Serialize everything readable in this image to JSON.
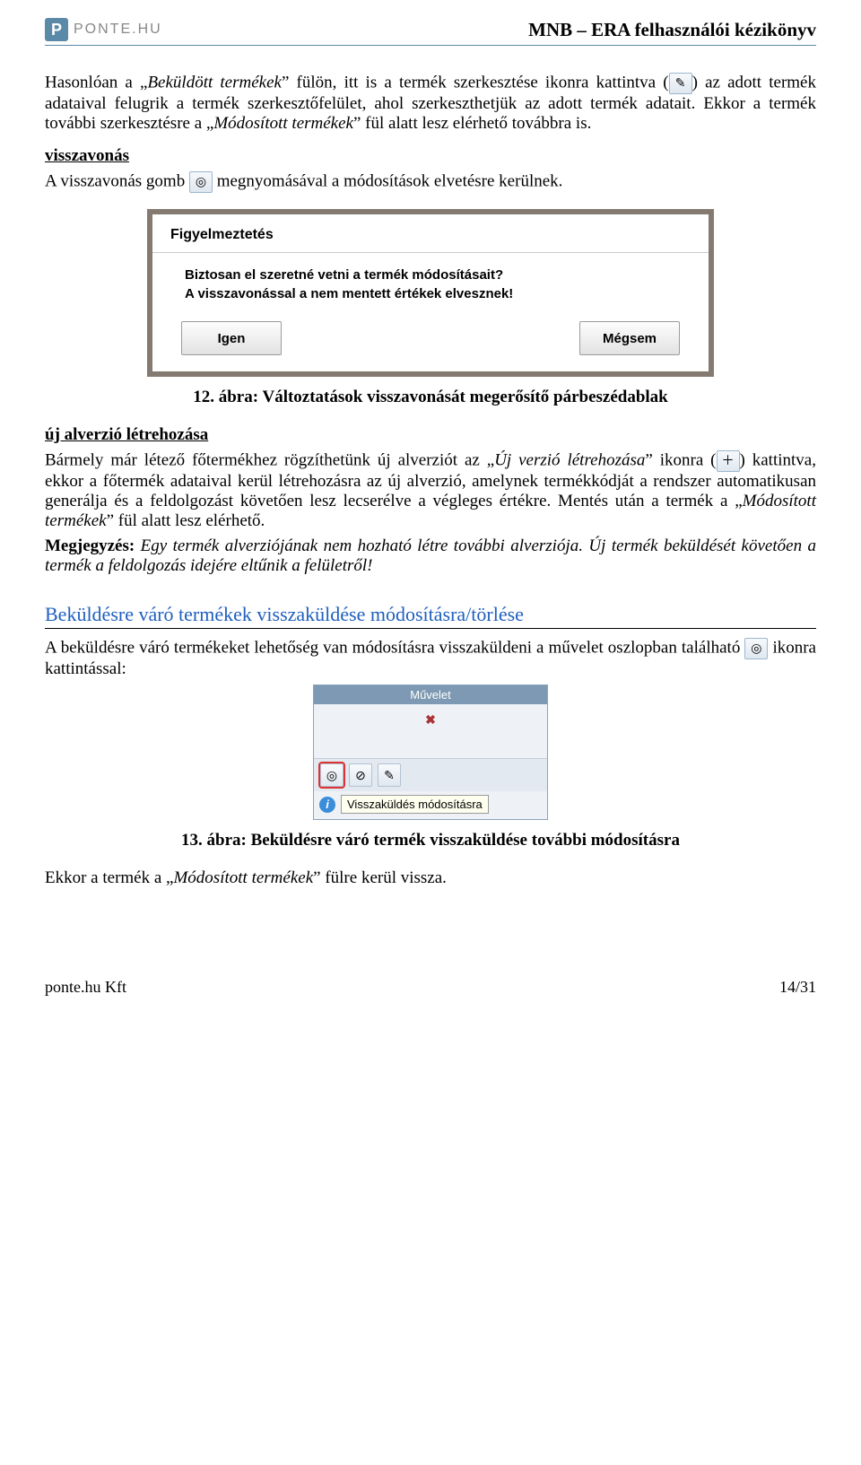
{
  "header": {
    "logo_text": "PONTE.HU",
    "doc_title": "MNB – ERA felhasználói kézikönyv"
  },
  "para1_a": "Hasonlóan a „",
  "para1_b_italic": "Beküldött termékek",
  "para1_c": "” fülön, itt is a termék szerkesztése ikonra kattintva (",
  "para1_d": ") az adott termék adataival felugrik a termék szerkesztőfelület, ahol szerkeszthetjük az adott termék adatait. Ekkor a termék további szerkesztésre a „",
  "para1_e_italic": "Módosított termékek",
  "para1_f": "” fül alatt lesz elérhető továbbra is.",
  "sec1_head": "visszavonás",
  "sec1_line_a": "A visszavonás gomb ",
  "sec1_line_b": " megnyomásával a módosítások elvetésre kerülnek.",
  "dialog": {
    "title": "Figyelmeztetés",
    "line1": "Biztosan el szeretné vetni a termék módosításait?",
    "line2": "A visszavonással a nem mentett értékek elvesznek!",
    "btn_yes": "Igen",
    "btn_no": "Mégsem"
  },
  "caption12": "12. ábra: Változtatások visszavonását megerősítő párbeszédablak",
  "sec2_head": "új alverzió létrehozása",
  "para2_a": "Bármely már létező főtermékhez rögzíthetünk új alverziót az „",
  "para2_b_italic": "Új verzió létrehozása",
  "para2_c": "” ikonra (",
  "para2_d": ") kattintva, ekkor a főtermék adataival kerül létrehozásra az új alverzió, amelynek termékkódját a rendszer automatikusan generálja és a feldolgozást követően lesz lecserélve a végleges értékre. Mentés után a termék a „",
  "para2_e_italic": "Módosított termékek",
  "para2_f": "” fül alatt lesz elérhető.",
  "note_label": "Megjegyzés:",
  "note_text": " Egy termék alverziójának nem hozható létre további alverziója. Új termék beküldését követően a termék a feldolgozás idejére eltűnik a felületről!",
  "sec3_title": "Beküldésre váró termékek visszaküldése módosításra/törlése",
  "para3_a": "A beküldésre váró termékeket lehetőség van módosításra visszaküldeni a művelet oszlopban található ",
  "para3_b": " ikonra kattintással:",
  "shot": {
    "col_header": "Művelet",
    "tooltip": "Visszaküldés módosításra"
  },
  "caption13": "13. ábra: Beküldésre váró termék visszaküldése további módosításra",
  "para4_a": "Ekkor a termék a „",
  "para4_b_italic": "Módosított termékek",
  "para4_c": "” fülre kerül vissza.",
  "footer": {
    "left": "ponte.hu Kft",
    "right": "14/31"
  },
  "icons": {
    "edit": "✎",
    "undo": "◎",
    "newver": "＋",
    "return": "◎",
    "delete": "✖",
    "forbid": "⊘",
    "pen": "✎"
  }
}
